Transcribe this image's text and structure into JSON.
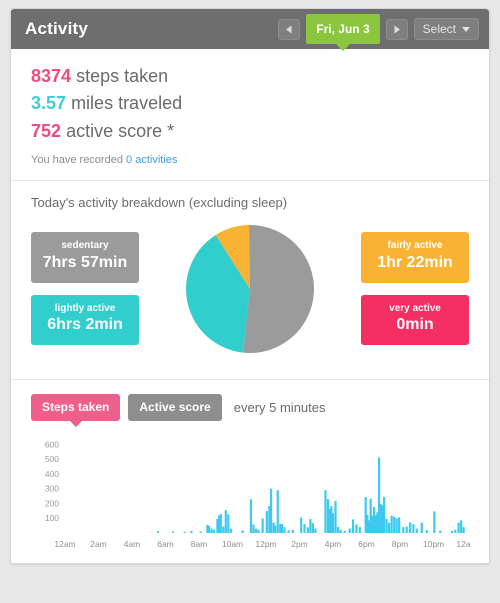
{
  "header": {
    "title": "Activity",
    "prev_label": "◀",
    "next_label": "▶",
    "date_label": "Fri, Jun 3",
    "select_label": "Select",
    "icons": {
      "prev": "chevron-left-icon",
      "next": "chevron-right-icon",
      "caret": "chevron-down-icon"
    },
    "colors": {
      "bar": "#6e6e6e",
      "date_pill": "#8cc63e"
    }
  },
  "summary": {
    "steps": {
      "value": "8374",
      "label": "steps taken",
      "color": "#ef4b7e"
    },
    "miles": {
      "value": "3.57",
      "label": "miles traveled",
      "color": "#3ecfd6"
    },
    "score": {
      "value": "752",
      "label": "active score *",
      "color": "#ef4b7e"
    },
    "recorded_prefix": "You have recorded",
    "recorded_count": "0",
    "recorded_suffix": "activities",
    "recorded_link_color": "#3f9fd8"
  },
  "breakdown": {
    "title": "Today's activity breakdown (excluding sleep)",
    "left": [
      {
        "name": "sedentary",
        "label": "sedentary",
        "value": "7hrs 57min",
        "color": "#9b9b9b"
      },
      {
        "name": "lightly-active",
        "label": "lightly active",
        "value": "6hrs 2min",
        "color": "#32cdcd"
      }
    ],
    "right": [
      {
        "name": "fairly-active",
        "label": "fairly active",
        "value": "1hr 22min",
        "color": "#f9b233"
      },
      {
        "name": "very-active",
        "label": "very active",
        "value": "0min",
        "color": "#f42f63"
      }
    ]
  },
  "chart_section": {
    "tabs": [
      {
        "label": "Steps taken",
        "active": true,
        "color": "#ef5f8c"
      },
      {
        "label": "Active score",
        "active": false,
        "color": "#8e8e8e"
      }
    ],
    "interval_label": "every 5 minutes"
  },
  "chart_data": [
    {
      "type": "pie",
      "title": "Today's activity breakdown (excluding sleep)",
      "labels": [
        "sedentary",
        "lightly active",
        "fairly active",
        "very active"
      ],
      "values": [
        477,
        362,
        82,
        1
      ],
      "value_units": "minutes",
      "display_values": [
        "7hrs 57min",
        "6hrs 2min",
        "1hr 22min",
        "0min"
      ],
      "colors": [
        "#9b9b9b",
        "#32cdcd",
        "#f9b233",
        "#f42f63"
      ],
      "legend": "sides",
      "start_angle_deg": 0,
      "direction": "clockwise"
    },
    {
      "type": "bar",
      "title": "Steps taken",
      "subtitle": "every 5 minutes",
      "xlabel": "",
      "ylabel": "",
      "ylim": [
        0,
        650
      ],
      "yticks": [
        100,
        200,
        300,
        400,
        500,
        600
      ],
      "grid": false,
      "legend_position": "none",
      "bar_color": "#3fc9ef",
      "x_tick_labels": [
        "12am",
        "2am",
        "4am",
        "6am",
        "8am",
        "10am",
        "12pm",
        "2pm",
        "4pm",
        "6pm",
        "8pm",
        "10pm",
        "12am"
      ],
      "x_tick_hours": [
        0,
        2,
        4,
        6,
        8,
        10,
        12,
        14,
        16,
        18,
        20,
        22,
        24
      ],
      "x_unit": "hours",
      "x_range_hours": [
        0,
        24
      ],
      "points": [
        {
          "t": 5.55,
          "v": 12
        },
        {
          "t": 6.45,
          "v": 10
        },
        {
          "t": 7.15,
          "v": 8
        },
        {
          "t": 7.55,
          "v": 14
        },
        {
          "t": 8.1,
          "v": 10
        },
        {
          "t": 8.5,
          "v": 55
        },
        {
          "t": 8.6,
          "v": 48
        },
        {
          "t": 8.75,
          "v": 30
        },
        {
          "t": 8.9,
          "v": 22
        },
        {
          "t": 9.1,
          "v": 95
        },
        {
          "t": 9.2,
          "v": 118
        },
        {
          "t": 9.3,
          "v": 128
        },
        {
          "t": 9.45,
          "v": 44
        },
        {
          "t": 9.6,
          "v": 155
        },
        {
          "t": 9.75,
          "v": 126
        },
        {
          "t": 9.9,
          "v": 30
        },
        {
          "t": 10.6,
          "v": 18
        },
        {
          "t": 11.1,
          "v": 228
        },
        {
          "t": 11.25,
          "v": 58
        },
        {
          "t": 11.4,
          "v": 30
        },
        {
          "t": 11.55,
          "v": 22
        },
        {
          "t": 11.8,
          "v": 98
        },
        {
          "t": 12.05,
          "v": 148
        },
        {
          "t": 12.2,
          "v": 182
        },
        {
          "t": 12.3,
          "v": 300
        },
        {
          "t": 12.45,
          "v": 70
        },
        {
          "t": 12.55,
          "v": 50
        },
        {
          "t": 12.7,
          "v": 290
        },
        {
          "t": 12.85,
          "v": 62
        },
        {
          "t": 12.95,
          "v": 60
        },
        {
          "t": 13.1,
          "v": 40
        },
        {
          "t": 13.35,
          "v": 18
        },
        {
          "t": 13.6,
          "v": 22
        },
        {
          "t": 14.1,
          "v": 105
        },
        {
          "t": 14.3,
          "v": 60
        },
        {
          "t": 14.5,
          "v": 38
        },
        {
          "t": 14.65,
          "v": 94
        },
        {
          "t": 14.8,
          "v": 66
        },
        {
          "t": 14.95,
          "v": 30
        },
        {
          "t": 15.55,
          "v": 290
        },
        {
          "t": 15.7,
          "v": 230
        },
        {
          "t": 15.8,
          "v": 162
        },
        {
          "t": 15.9,
          "v": 182
        },
        {
          "t": 16.0,
          "v": 134
        },
        {
          "t": 16.15,
          "v": 218
        },
        {
          "t": 16.3,
          "v": 42
        },
        {
          "t": 16.45,
          "v": 22
        },
        {
          "t": 16.7,
          "v": 16
        },
        {
          "t": 17.0,
          "v": 30
        },
        {
          "t": 17.2,
          "v": 92
        },
        {
          "t": 17.4,
          "v": 58
        },
        {
          "t": 17.6,
          "v": 40
        },
        {
          "t": 17.95,
          "v": 244
        },
        {
          "t": 18.05,
          "v": 124
        },
        {
          "t": 18.15,
          "v": 86
        },
        {
          "t": 18.25,
          "v": 232
        },
        {
          "t": 18.35,
          "v": 118
        },
        {
          "t": 18.45,
          "v": 176
        },
        {
          "t": 18.55,
          "v": 120
        },
        {
          "t": 18.65,
          "v": 140
        },
        {
          "t": 18.75,
          "v": 512
        },
        {
          "t": 18.85,
          "v": 196
        },
        {
          "t": 18.95,
          "v": 188
        },
        {
          "t": 19.05,
          "v": 244
        },
        {
          "t": 19.2,
          "v": 96
        },
        {
          "t": 19.35,
          "v": 70
        },
        {
          "t": 19.5,
          "v": 118
        },
        {
          "t": 19.65,
          "v": 110
        },
        {
          "t": 19.8,
          "v": 100
        },
        {
          "t": 19.95,
          "v": 106
        },
        {
          "t": 20.2,
          "v": 40
        },
        {
          "t": 20.4,
          "v": 44
        },
        {
          "t": 20.6,
          "v": 72
        },
        {
          "t": 20.8,
          "v": 60
        },
        {
          "t": 21.0,
          "v": 30
        },
        {
          "t": 21.3,
          "v": 70
        },
        {
          "t": 21.6,
          "v": 20
        },
        {
          "t": 22.05,
          "v": 146
        },
        {
          "t": 22.4,
          "v": 16
        },
        {
          "t": 23.1,
          "v": 14
        },
        {
          "t": 23.3,
          "v": 22
        },
        {
          "t": 23.5,
          "v": 70
        },
        {
          "t": 23.65,
          "v": 86
        },
        {
          "t": 23.8,
          "v": 40
        }
      ]
    }
  ]
}
